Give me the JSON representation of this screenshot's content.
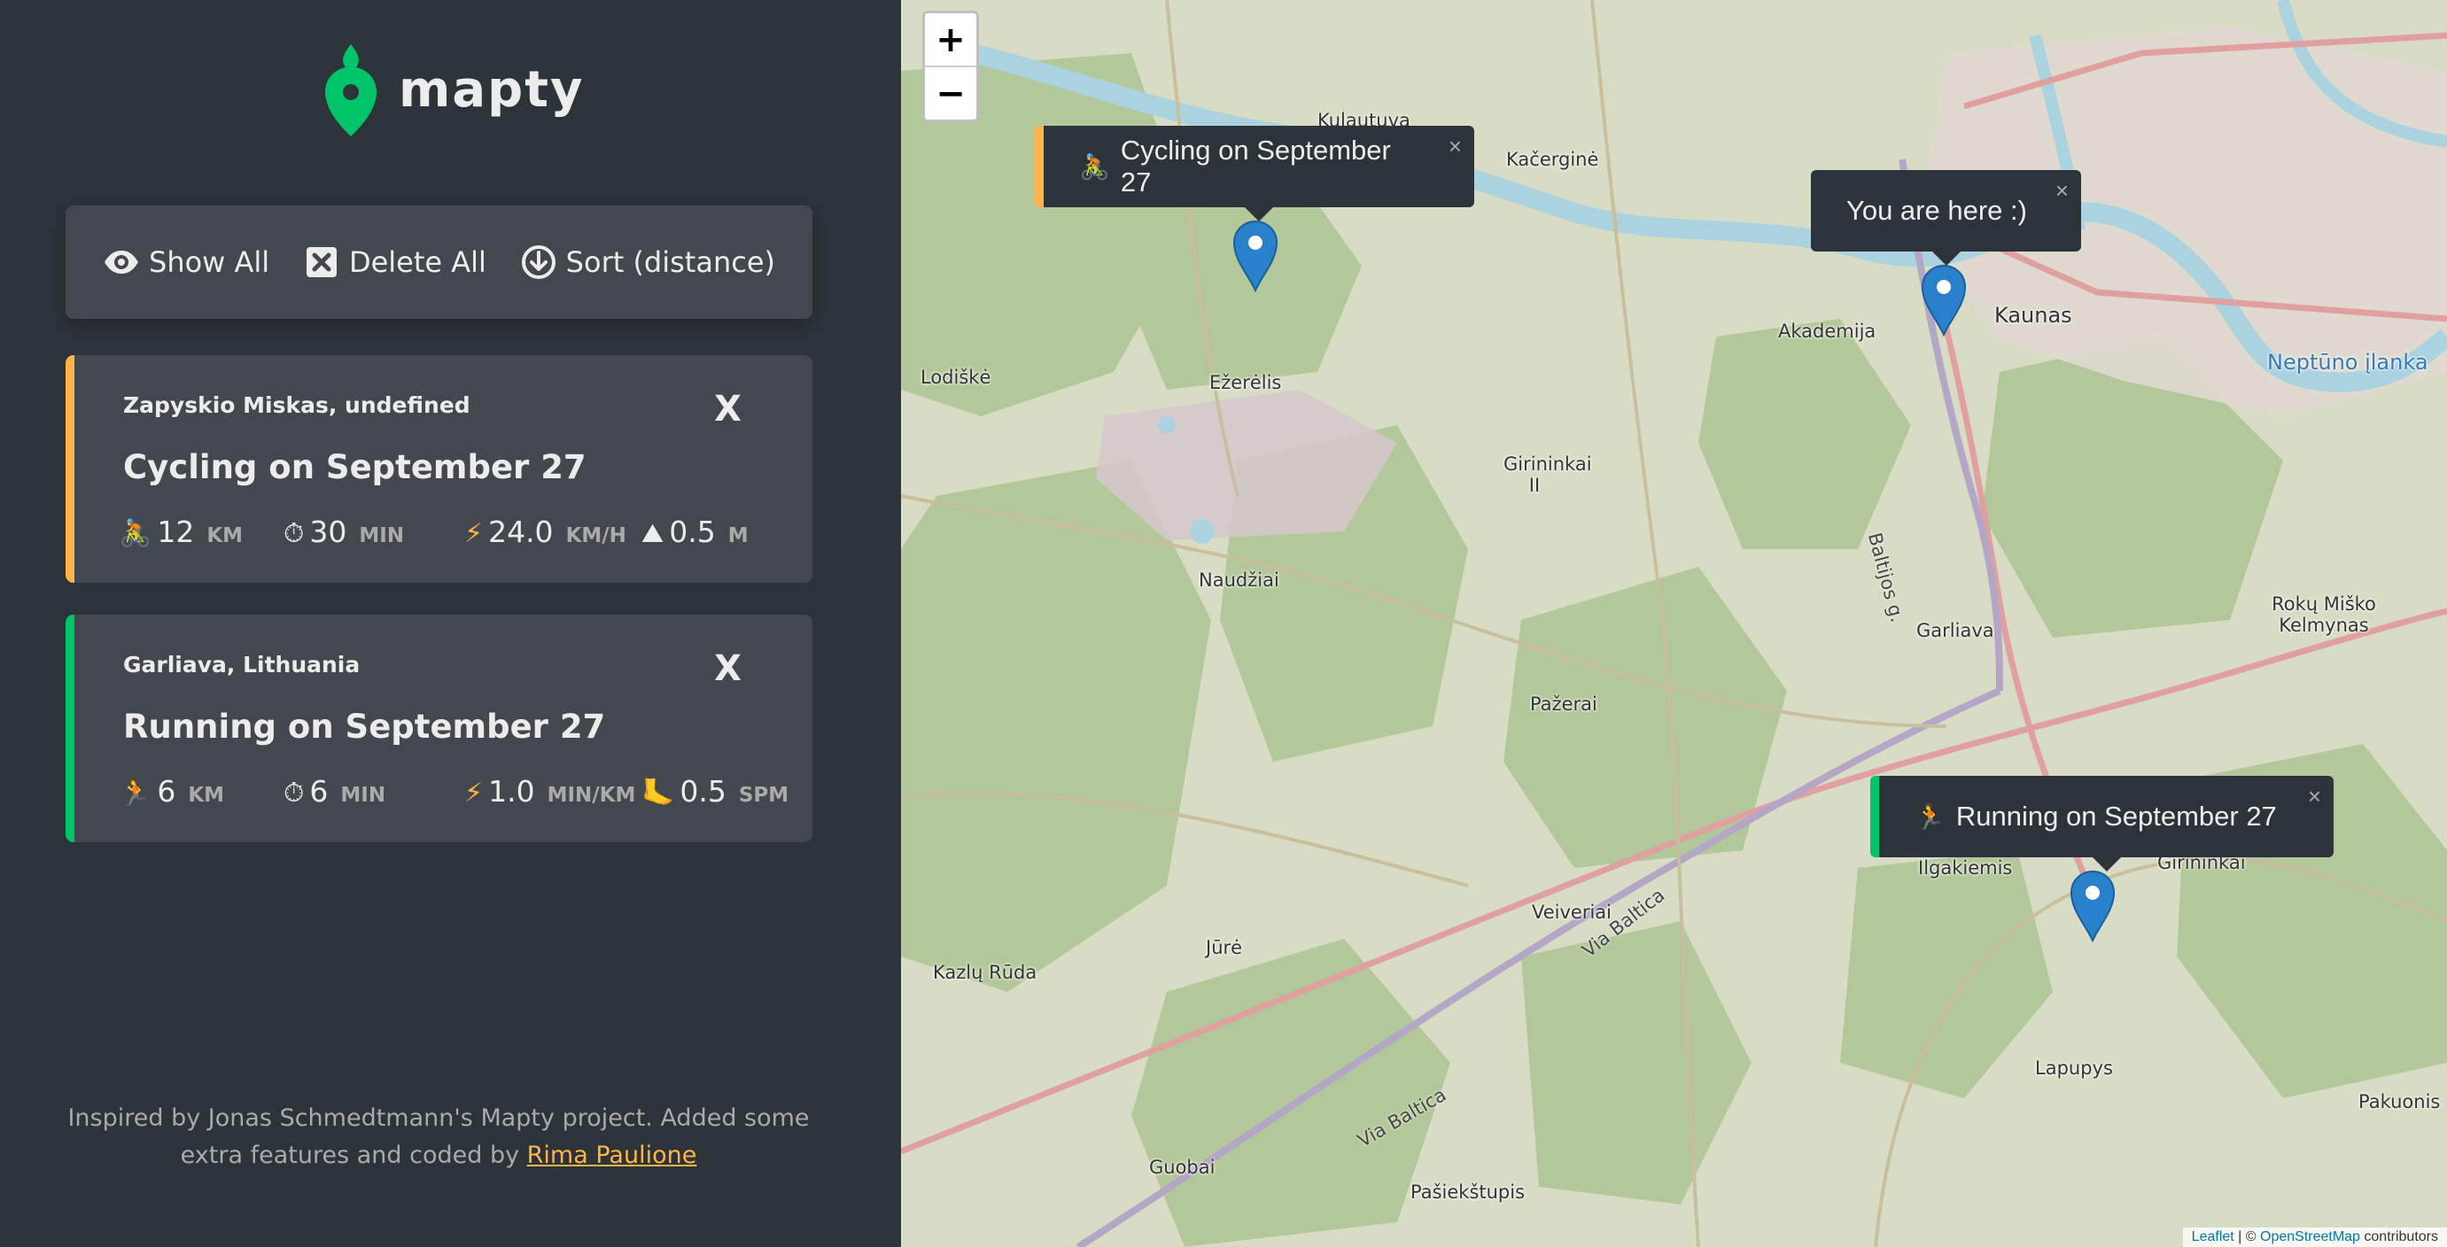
{
  "app": {
    "name": "mapty"
  },
  "toolbar": {
    "show_all": "Show All",
    "delete_all": "Delete All",
    "sort": "Sort (distance)"
  },
  "workouts": [
    {
      "type": "cycling",
      "location": "Zapyskio Miskas, undefined",
      "title": "Cycling on September 27",
      "close": "X",
      "color": "#ffb545",
      "details": [
        {
          "icon": "cyclist-icon",
          "value": "12",
          "unit": "KM"
        },
        {
          "icon": "stopwatch-icon",
          "value": "30",
          "unit": "MIN"
        },
        {
          "icon": "lightning-icon",
          "value": "24.0",
          "unit": "KM/H"
        },
        {
          "icon": "mountain-icon",
          "value": "0.5",
          "unit": "M"
        }
      ]
    },
    {
      "type": "running",
      "location": "Garliava, Lithuania",
      "title": "Running on September 27",
      "close": "X",
      "color": "#00c46a",
      "details": [
        {
          "icon": "runner-icon",
          "value": "6",
          "unit": "KM"
        },
        {
          "icon": "stopwatch-icon",
          "value": "6",
          "unit": "MIN"
        },
        {
          "icon": "lightning-icon",
          "value": "1.0",
          "unit": "MIN/KM"
        },
        {
          "icon": "footprint-icon",
          "value": "0.5",
          "unit": "SPM"
        }
      ]
    }
  ],
  "footer": {
    "text": "Inspired by Jonas Schmedtmann's Mapty project. Added some extra features and coded by",
    "author_link": "Rima Paulione"
  },
  "map": {
    "zoom_in": "+",
    "zoom_out": "−",
    "popups": {
      "cycling": "Cycling on September 27",
      "you_are_here": "You are here :)",
      "running": "Running on September 27",
      "close": "×"
    },
    "places": {
      "kulautuva": "Kulautuva",
      "kacergine": "Kačerginė",
      "akademija": "Akademija",
      "kaunas": "Kaunas",
      "neptuno": "Neptūno įlanka",
      "lodiske": "Lodiškė",
      "ezerelis": "Ežerėlis",
      "girininkai2": "Girininkai II",
      "naudziai": "Naudžiai",
      "baltijos": "Baltijos g.",
      "garliava": "Garliava",
      "roku": "Rokų Miško Kelmynas",
      "pazerai": "Pažerai",
      "ilgakiemis": "Ilgakiemis",
      "girininkai": "Girininkai",
      "veiveriai": "Veiveriai",
      "via_baltica": "Via Baltica",
      "jure": "Jūrė",
      "kazlu_ruda": "Kazlų Rūda",
      "lapupys": "Lapupys",
      "pakuonis": "Pakuonis",
      "guobai": "Guobai",
      "pasiekstupis": "Pašiekštupis"
    },
    "attribution": {
      "leaflet": "Leaflet",
      "sep": " | © ",
      "osm": "OpenStreetMap",
      "contributors": " contributors"
    }
  }
}
